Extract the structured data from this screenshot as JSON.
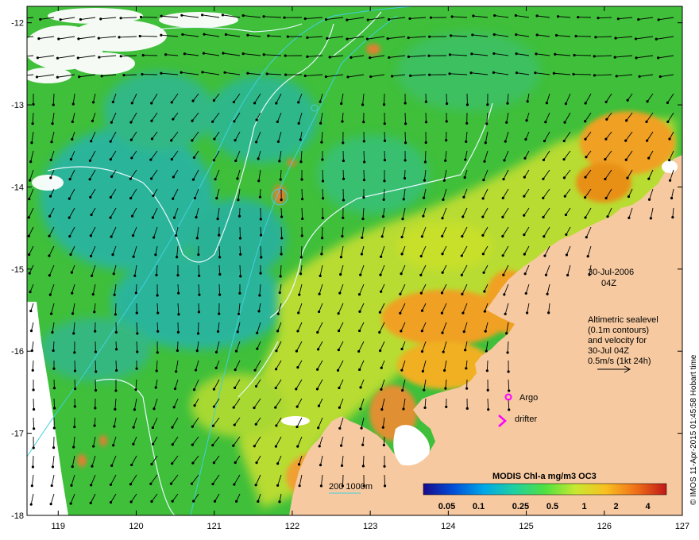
{
  "map": {
    "lon_range": [
      118.6,
      127.0
    ],
    "lat_range": [
      -18.0,
      -11.8
    ],
    "lon_ticks": [
      "119",
      "120",
      "121",
      "122",
      "123",
      "124",
      "125",
      "126",
      "127"
    ],
    "lat_ticks": [
      "-12",
      "-13",
      "-14",
      "-15",
      "-16",
      "-17",
      "-18"
    ],
    "colors": {
      "land": "#f6c9a0",
      "ocean_green": "#3fbf3a",
      "ocean_teal": "#2bb59a",
      "shelf_yellow": "#c8e02a",
      "coastal_orange": "#f0a020",
      "cloud": "#ffffff",
      "contour": "#e8f8ff",
      "isobath": "#40d0e0",
      "arrow": "#000000",
      "marker": "#ff00ff"
    }
  },
  "date": {
    "line1": "30-Jul-2006",
    "line2": "04Z"
  },
  "legend": {
    "lines": [
      "Altimetric sealevel",
      "(0.1m contours)",
      "and velocity for",
      "30-Jul 04Z",
      "0.5m/s (1kt 24h)"
    ]
  },
  "markers": {
    "argo_label": "Argo",
    "drifter_label": "drifter"
  },
  "isobath_label": "200  1000m",
  "colorbar": {
    "title": "MODIS Chl-a mg/m3 OC3",
    "ticks": [
      "0.05",
      "0.1",
      "0.25",
      "0.5",
      "1",
      "2",
      "4"
    ],
    "stops": [
      "#1a0a8c",
      "#0050d8",
      "#00a8e8",
      "#20d0a0",
      "#50e040",
      "#c8e830",
      "#f8c020",
      "#f07018",
      "#c01818"
    ]
  },
  "credit": "© IMOS 11-Apr-2015 01:45:58 Hobart time"
}
